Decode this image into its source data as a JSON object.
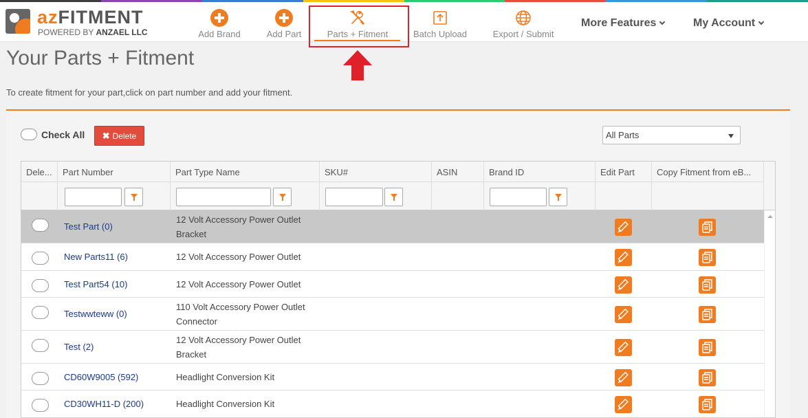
{
  "logo": {
    "brand_az": "az",
    "brand_fitment": "FITMENT",
    "powered_by": "POWERED BY",
    "company": "ANZAEL LLC"
  },
  "nav": {
    "items": [
      {
        "label": "Add Brand",
        "icon": "plus-circle-icon"
      },
      {
        "label": "Add Part",
        "icon": "plus-circle-icon"
      },
      {
        "label": "Parts + Fitment",
        "icon": "tools-icon",
        "active": true
      },
      {
        "label": "Batch Upload",
        "icon": "upload-icon"
      },
      {
        "label": "Export / Submit",
        "icon": "globe-icon"
      }
    ],
    "more_features": "More Features",
    "my_account": "My Account"
  },
  "page": {
    "title": "Your Parts + Fitment",
    "hint": "To create fitment for your part,click on part number and add your fitment."
  },
  "toolbar": {
    "check_all": "Check All",
    "delete_label": "Delete",
    "filter_selected": "All Parts"
  },
  "grid": {
    "columns": [
      "Dele...",
      "Part Number",
      "Part Type Name",
      "SKU#",
      "ASIN",
      "Brand ID",
      "Edit Part",
      "Copy Fitment from eB..."
    ],
    "rows": [
      {
        "part": "Test Part (0)",
        "type": "12 Volt Accessory Power Outlet Bracket",
        "selected": true
      },
      {
        "part": "New Parts11 (6)",
        "type": "12 Volt Accessory Power Outlet"
      },
      {
        "part": "Test Part54 (10)",
        "type": "12 Volt Accessory Power Outlet"
      },
      {
        "part": "Testwwteww (0)",
        "type": "110 Volt Accessory Power Outlet Connector"
      },
      {
        "part": "Test (2)",
        "type": "12 Volt Accessory Power Outlet Bracket"
      },
      {
        "part": "CD60W9005 (592)",
        "type": "Headlight Conversion Kit"
      },
      {
        "part": "CD30WH11-D (200)",
        "type": "Headlight Conversion Kit"
      }
    ]
  },
  "colors": {
    "accent": "#f07c21",
    "delete": "#e24c3c",
    "highlight": "#e0212b",
    "link": "#1a3a8c"
  }
}
